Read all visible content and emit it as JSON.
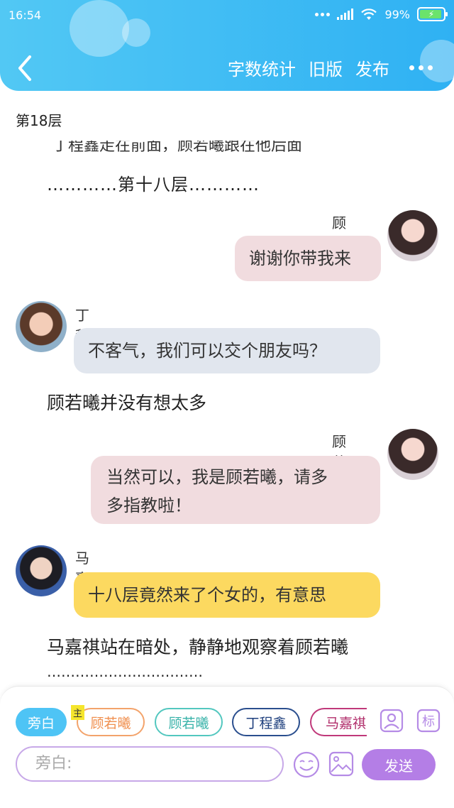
{
  "status": {
    "time": "16:54",
    "battery": "99%"
  },
  "header": {
    "actions": [
      "字数统计",
      "旧版",
      "发布"
    ]
  },
  "content": {
    "floor_label": "第18层",
    "cut_text": "丁程鑫走在前面，顾若曦跟在他后面",
    "floor_divider": "…………第十八层…………",
    "messages": [
      {
        "side": "right",
        "name": "顾若曦",
        "text": "谢谢你带我来",
        "color": "#f1dcdf"
      },
      {
        "side": "left",
        "name": "丁程鑫",
        "text": "不客气，我们可以交个朋友吗？",
        "color": "#e1e6ee"
      },
      {
        "side": "right",
        "name": "顾若曦",
        "text_line1": "当然可以，我是顾若曦，请多",
        "text_line2": "多指教啦！",
        "color": "#f1dcdf"
      },
      {
        "side": "left",
        "name": "马嘉祺",
        "text": "十八层竟然来了个女的，有意思",
        "color": "#fcd960"
      }
    ],
    "narration1": "顾若曦并没有想太多",
    "narration2": "马嘉祺站在暗处，静静地观察着顾若曦",
    "dotted_end": "……………………………"
  },
  "composer": {
    "roles": [
      "旁白",
      "顾若曦",
      "顾若曦",
      "丁程鑫",
      "马嘉祺"
    ],
    "tag": "主",
    "icons": [
      "user-card-icon",
      "tag-icon"
    ],
    "placeholder": "旁白:",
    "send_label": "发送"
  }
}
